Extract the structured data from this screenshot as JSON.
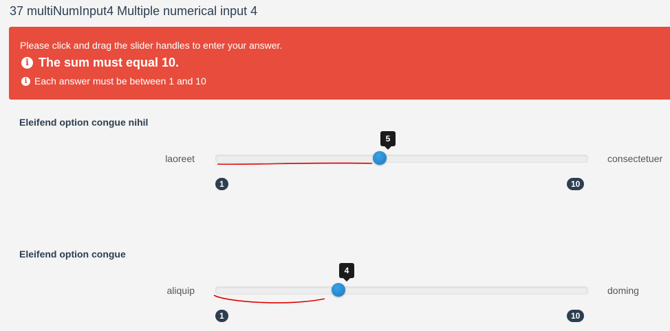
{
  "page": {
    "title": "37 multiNumInput4 Multiple numerical input 4"
  },
  "alert": {
    "instruction": "Please click and drag the slider handles to enter your answer.",
    "error_main": "The sum must equal 10.",
    "error_range": "Each answer must be between 1 and 10",
    "info_glyph": "i"
  },
  "sliders": [
    {
      "question": "Eleifend option congue nihil",
      "left_label": "laoreet",
      "right_label": "consectetuer",
      "min": 1,
      "max": 10,
      "value": 5,
      "min_label": "1",
      "max_label": "10",
      "value_label": "5"
    },
    {
      "question": "Eleifend option congue",
      "left_label": "aliquip",
      "right_label": "doming",
      "min": 1,
      "max": 10,
      "value": 4,
      "min_label": "1",
      "max_label": "10",
      "value_label": "4"
    }
  ],
  "colors": {
    "alert": "#e74c3c",
    "handle": "#1a78c2",
    "badge": "#2c3e50",
    "annotation": "#e00000"
  }
}
